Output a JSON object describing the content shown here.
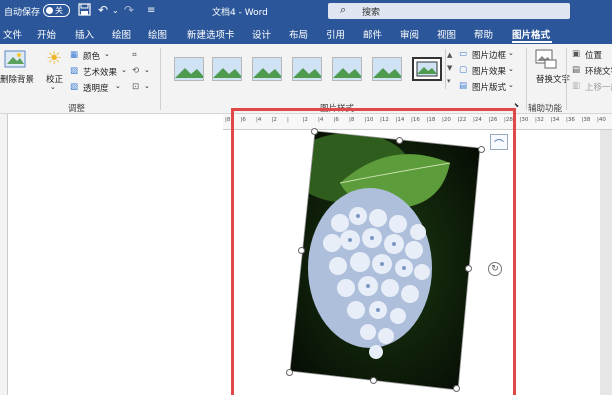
{
  "titlebar": {
    "autosave_label": "自动保存",
    "autosave_state": "关",
    "doc_title": "文档4 - Word",
    "search_placeholder": "搜索"
  },
  "menu": {
    "items": [
      "文件",
      "开始",
      "插入",
      "绘图",
      "设计",
      "新建选项卡",
      "设计",
      "布局",
      "引用",
      "邮件",
      "审阅",
      "视图",
      "帮助",
      "图片格式"
    ],
    "active": "图片格式"
  },
  "ribbon": {
    "remove_bg": "删除背景",
    "corrections": "校正",
    "color": "颜色",
    "artistic_effects": "艺术效果",
    "transparency": "透明度",
    "adjust_group": "调整",
    "picture_styles_group": "图片样式",
    "border": "图片边框",
    "effects": "图片效果",
    "layout": "图片版式",
    "alt_text": "替换文字",
    "accessibility_group": "辅助功能",
    "position": "位置",
    "wrap_text": "环绕文字",
    "bring_forward": "上移一层"
  },
  "ruler": {
    "marks": [
      "8",
      "6",
      "4",
      "2",
      "",
      "2",
      "4",
      "6",
      "8",
      "10",
      "12",
      "14",
      "16",
      "18",
      "20",
      "22",
      "24",
      "26",
      "28",
      "30",
      "32",
      "34",
      "36",
      "38",
      "40"
    ]
  },
  "colors": {
    "titlebar": "#2b579a",
    "highlight": "#e04848",
    "ribbon": "#f3f3f3"
  }
}
